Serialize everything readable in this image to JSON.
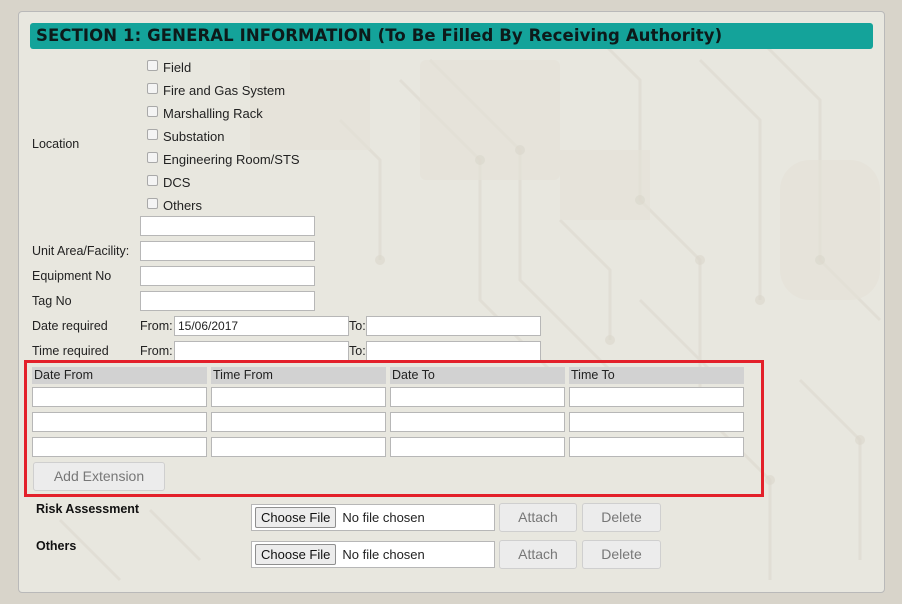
{
  "section": {
    "title": "SECTION 1: GENERAL INFORMATION (To Be Filled By Receiving Authority)"
  },
  "location": {
    "label": "Location",
    "options": [
      "Field",
      "Fire and Gas System",
      "Marshalling Rack",
      "Substation",
      "Engineering Room/STS",
      "DCS",
      "Others"
    ],
    "others_value": ""
  },
  "fields": {
    "unit_area": {
      "label": "Unit Area/Facility:",
      "value": ""
    },
    "equipment_no": {
      "label": "Equipment No",
      "value": ""
    },
    "tag_no": {
      "label": "Tag No",
      "value": ""
    }
  },
  "date_required": {
    "label": "Date required",
    "from_label": "From:",
    "from_value": "15/06/2017",
    "to_label": "To:",
    "to_value": ""
  },
  "time_required": {
    "label": "Time required",
    "from_label": "From:",
    "from_value": "",
    "to_label": "To:",
    "to_value": ""
  },
  "extension": {
    "headers": [
      "Date From",
      "Time From",
      "Date To",
      "Time To"
    ],
    "rows": [
      [
        "",
        "",
        "",
        ""
      ],
      [
        "",
        "",
        "",
        ""
      ],
      [
        "",
        "",
        "",
        ""
      ]
    ],
    "add_button": "Add Extension"
  },
  "attachments": [
    {
      "label": "Risk Assessment",
      "choose_label": "Choose File",
      "status": "No file chosen",
      "attach_label": "Attach",
      "delete_label": "Delete"
    },
    {
      "label": "Others",
      "choose_label": "Choose File",
      "status": "No file chosen",
      "attach_label": "Attach",
      "delete_label": "Delete"
    }
  ],
  "colors": {
    "header_bg": "#14a39a",
    "highlight_border": "#e3202a",
    "table_header_bg": "#d2d2d2"
  }
}
